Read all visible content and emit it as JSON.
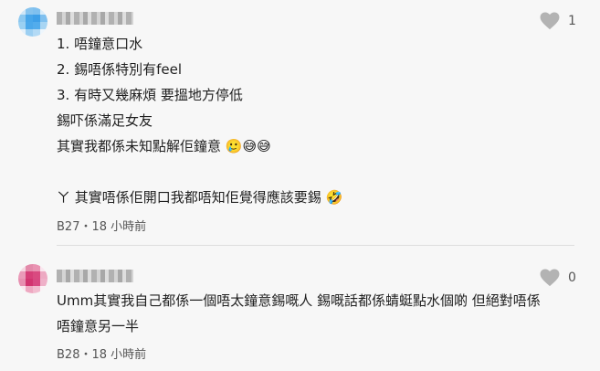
{
  "comments": [
    {
      "like_count": "1",
      "lines": [
        "1. 唔鐘意口水",
        "2. 錫唔係特別有feel",
        "3. 有時又幾麻煩 要搵地方停低",
        "錫吓係滿足女友",
        "其實我都係未知點解佢鐘意 🥲😅😅",
        "",
        "ㄚ 其實唔係佢開口我都唔知佢覺得應該要錫 🤣"
      ],
      "meta": "B27・18 小時前"
    },
    {
      "like_count": "0",
      "lines": [
        "Umm其實我自己都係一個唔太鐘意錫嘅人 錫嘅話都係蜻蜓點水個啲 但絕對唔係",
        "唔鐘意另一半"
      ],
      "meta": "B28・18 小時前"
    }
  ],
  "icons": {
    "like": "heart-icon"
  },
  "colors": {
    "background": "#f7f7f7",
    "heart": "#b3b3b3",
    "text": "#1f1f1f",
    "meta": "#555555"
  }
}
